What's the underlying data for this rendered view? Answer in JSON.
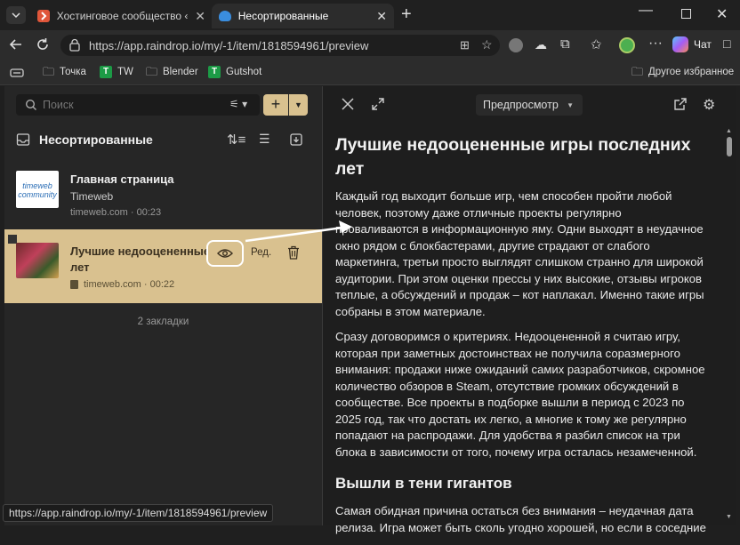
{
  "tabs": [
    {
      "title": "Хостинговое сообщество «Timeweb"
    },
    {
      "title": "Несортированные"
    }
  ],
  "address": {
    "url": "https://app.raindrop.io/my/-1/item/1818594961/preview"
  },
  "toolbar": {
    "chat_label": "Чат"
  },
  "bookmarks": {
    "items": [
      "Точка",
      "TW",
      "Blender",
      "Gutshot"
    ],
    "other": "Другое избранное"
  },
  "sidebar": {
    "search_placeholder": "Поиск",
    "collection_title": "Несортированные",
    "items": [
      {
        "title": "Главная страница",
        "subtitle": "Timeweb",
        "domain": "timeweb.com",
        "time": "00:23",
        "thumb_text": "timeweb community"
      },
      {
        "title_line1": "Лучшие недооцененные",
        "title_line2": "лет",
        "domain": "timeweb.com",
        "time": "00:22",
        "edit_label": "Ред."
      }
    ],
    "count": "2 закладки"
  },
  "preview": {
    "mode_label": "Предпросмотр",
    "title": "Лучшие недооцененные игры последних лет",
    "paragraphs": [
      "Каждый год выходит больше игр, чем способен пройти любой человек, поэтому даже отличные проекты регулярно проваливаются в информационную яму. Одни выходят в неудачное окно рядом с блокбастерами, другие страдают от слабого маркетинга, третьи просто выглядят слишком странно для широкой аудитории. При этом оценки прессы у них высокие, отзывы игроков теплые, а обсуждений и продаж – кот наплакал. Именно такие игры собраны в этом материале.",
      "Сразу договоримся о критериях. Недооцененной я считаю игру, которая при заметных достоинствах не получила соразмерного внимания: продажи ниже ожиданий самих разработчиков, скромное количество обзоров в Steam, отсутствие громких обсуждений в сообществе. Все проекты в подборке вышли в период с 2023 по 2025 год, так что достать их легко, а многие к тому же регулярно попадают на распродажи. Для удобства я разбил список на три блока в зависимости от того, почему игра осталась незамеченной."
    ],
    "section_title": "Вышли в тени гигантов",
    "section_paragraph": "Самая обидная причина остаться без внимания – неудачная дата релиза. Игра может быть сколь угодно хорошей, но если в соседние"
  },
  "status_url": "https://app.raindrop.io/my/-1/item/1818594961/preview",
  "colors": {
    "selected_row": "#d9c18f",
    "accent": "#d9c18f",
    "tw_green": "#1c9b46",
    "tab_favicon": "#e0563a",
    "edge_blue": "#3a8dde"
  }
}
